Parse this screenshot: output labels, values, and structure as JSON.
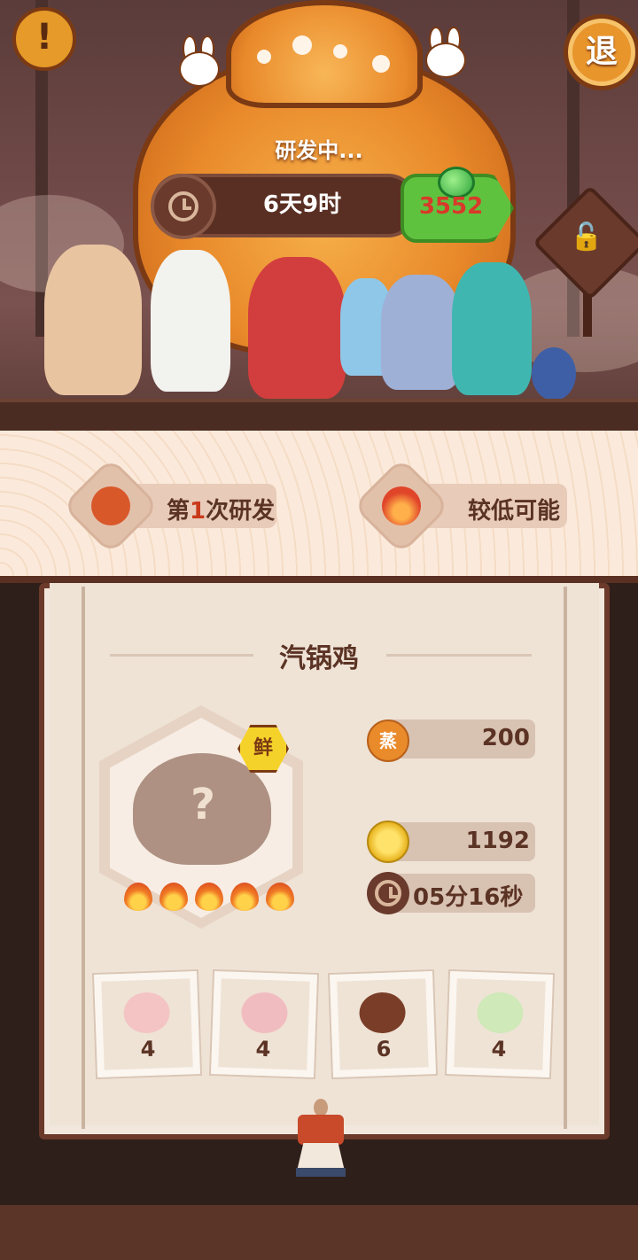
{
  "header": {
    "alert_glyph": "!",
    "exit_label": "退",
    "status_text": "研发中...",
    "timer_text": "6天9时",
    "jade_amount": "3552"
  },
  "icons": {
    "alert": "exclamation-icon",
    "exit": "exit-icon",
    "timer": "clock-icon",
    "jade": "jade-gem-icon",
    "lock": "unlock-icon",
    "pot": "pot-icon",
    "fire": "fire-icon"
  },
  "info": {
    "research_prefix": "第",
    "research_count": "1",
    "research_suffix": "次研发",
    "chance_label": "较低可能"
  },
  "dish": {
    "name": "汽锅鸡",
    "mystery_glyph": "?",
    "fresh_badge": "鲜",
    "flames": 5,
    "steam_label": "蒸",
    "steam_value": "200",
    "coin_value": "1192",
    "cook_time": "05分16秒"
  },
  "ingredients": [
    {
      "name": "ham-icon",
      "count": "4",
      "color": "#f4c4c4"
    },
    {
      "name": "pork-icon",
      "count": "4",
      "color": "#f1bcc0"
    },
    {
      "name": "mushroom-icon",
      "count": "6",
      "color": "#7a3e28"
    },
    {
      "name": "bamboo-shoot-icon",
      "count": "4",
      "color": "#cfe9b8"
    }
  ],
  "colors": {
    "accent_orange": "#e98a2b",
    "jade_green": "#5fc23f",
    "highlight_red": "#c83a1a",
    "text_brown": "#5b3324"
  }
}
